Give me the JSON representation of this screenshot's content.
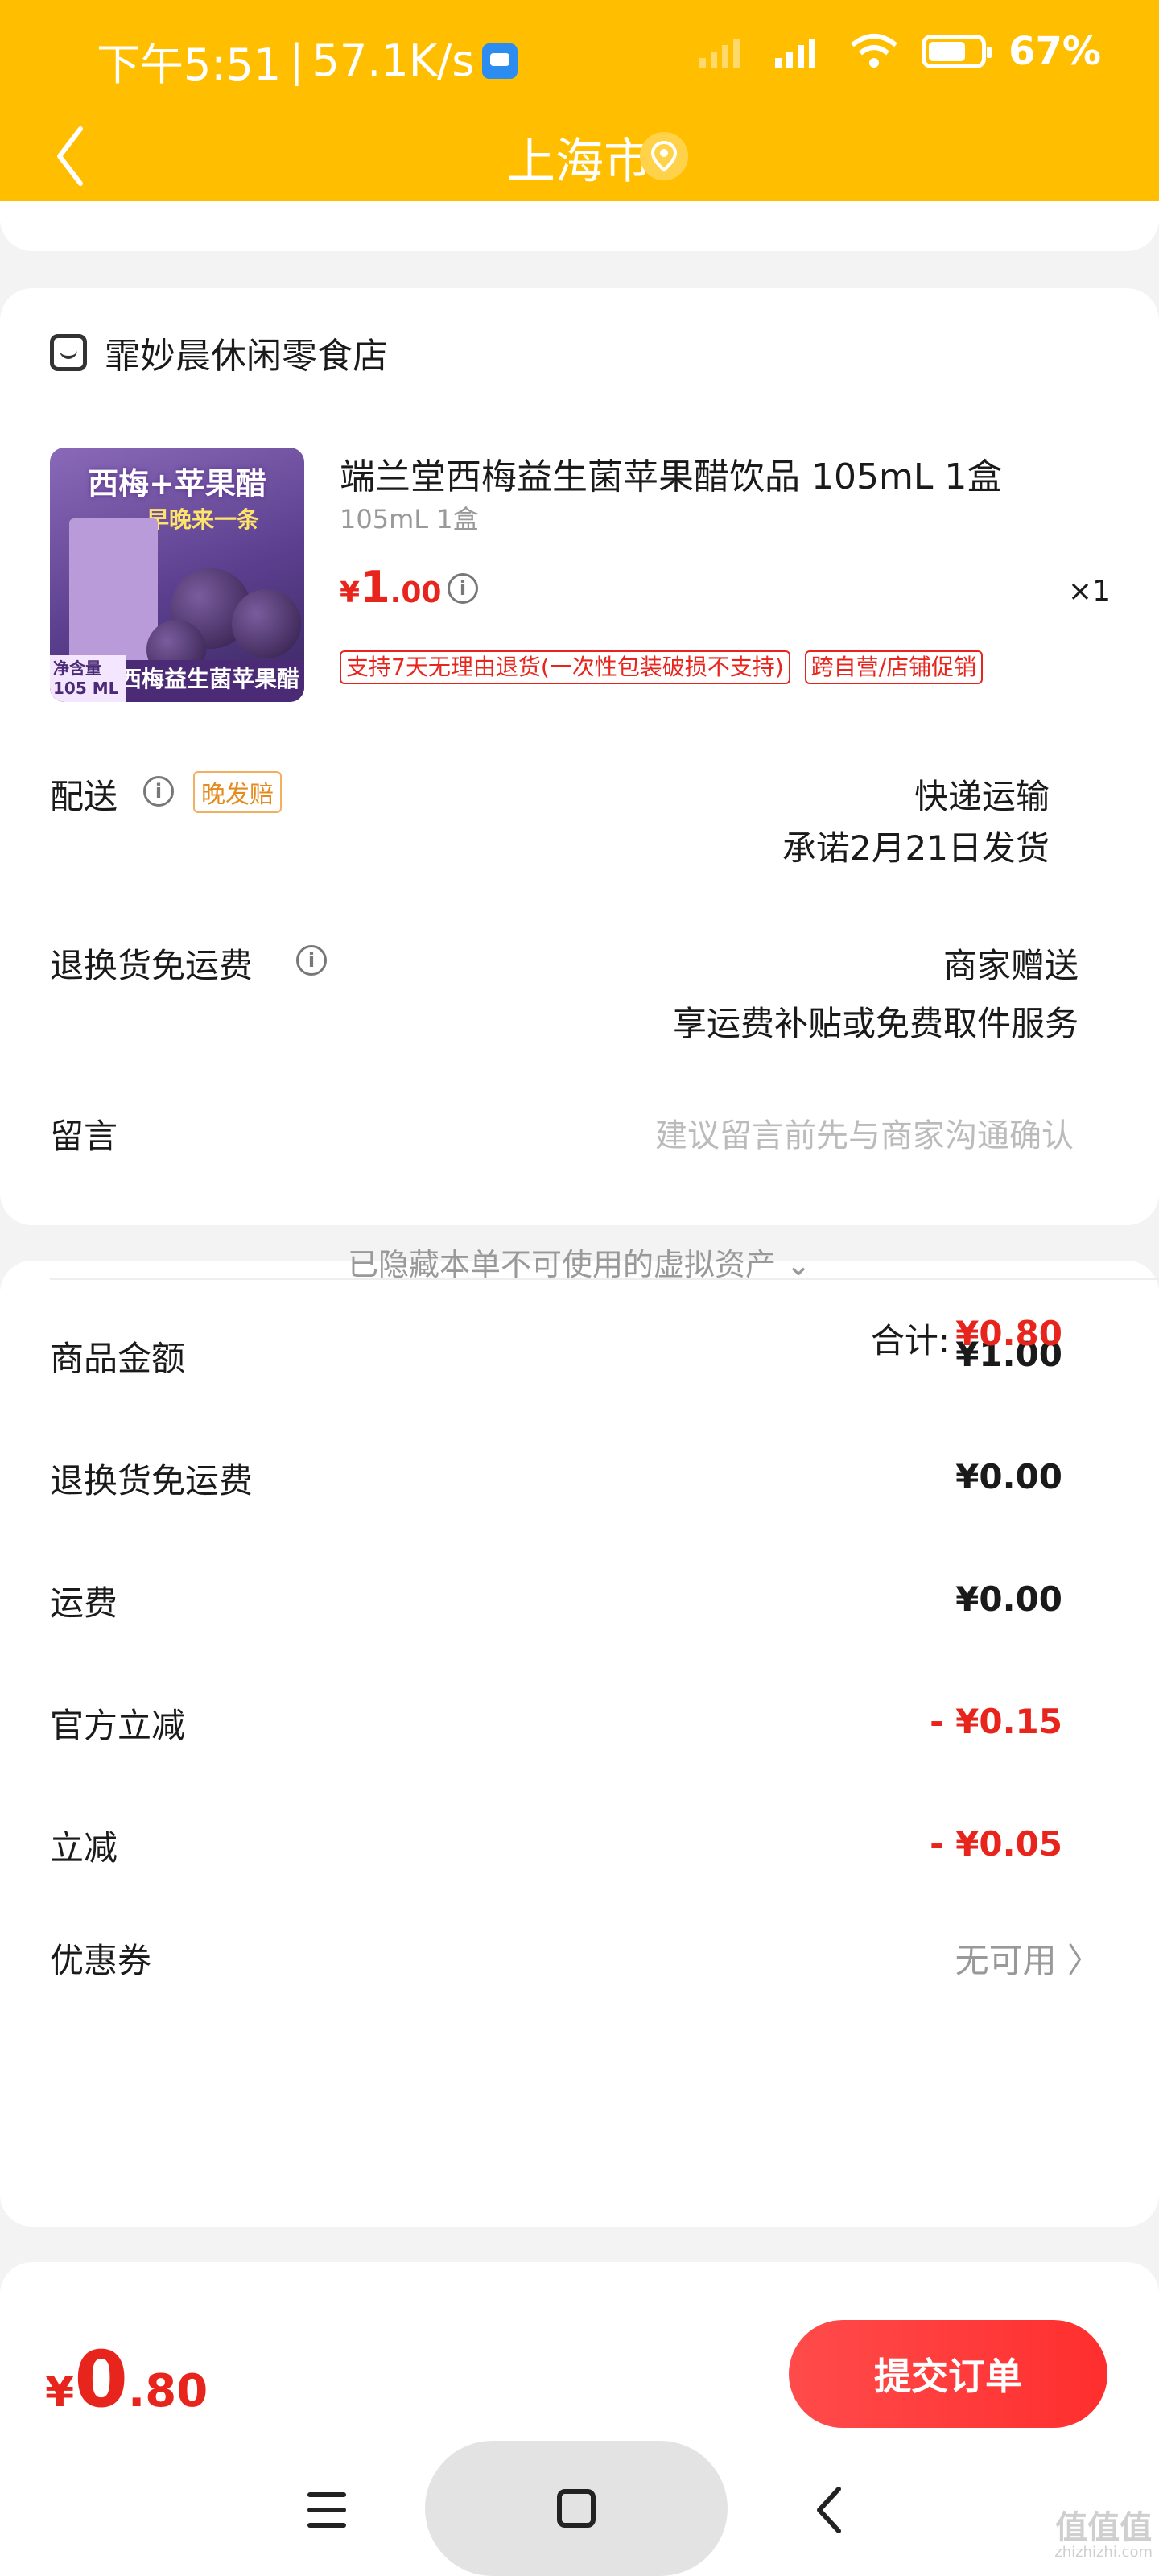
{
  "status_bar": {
    "time": "下午5:51",
    "separator": "|",
    "net_speed": "57.1K/s",
    "battery": "67%"
  },
  "header": {
    "title": "上海市",
    "back_icon": "chevron-left-icon",
    "location_icon": "location-pin-icon"
  },
  "shop": {
    "name": "霏妙晨休闲零食店",
    "icon": "shop-icon"
  },
  "product": {
    "image_texts": {
      "headline": "西梅+苹果醋",
      "subline": "早晚来一条",
      "bottom": "西梅益生菌苹果醋",
      "net_label": "净含量",
      "net_value": "105 ML"
    },
    "title": "端兰堂西梅益生菌苹果醋饮品 105mL 1盒",
    "spec": "105mL 1盒",
    "price_symbol": "¥",
    "price_int": "1",
    "price_dec": ".00",
    "quantity": "×1",
    "tags": [
      "支持7天无理由退货(一次性包装破损不支持)",
      "跨自营/店铺促销"
    ]
  },
  "delivery": {
    "label": "配送",
    "tag": "晚发赔",
    "method": "快递运输",
    "promise": "承诺2月21日发货"
  },
  "return_shipping": {
    "label": "退换货免运费",
    "value": "商家赠送",
    "desc": "享运费补贴或免费取件服务"
  },
  "memo": {
    "label": "留言",
    "placeholder": "建议留言前先与商家沟通确认"
  },
  "summary": {
    "rows": [
      {
        "label": "商品金额",
        "value": "¥1.00"
      },
      {
        "label": "退换货免运费",
        "value": "¥0.00"
      },
      {
        "label": "运费",
        "value": "¥0.00"
      },
      {
        "label": "官方立减",
        "value": "- ¥0.15"
      },
      {
        "label": "立减",
        "value": "- ¥0.05"
      }
    ],
    "coupon_label": "优惠券",
    "coupon_value": "无可用 〉",
    "hidden_assets": "已隐藏本单不可使用的虚拟资产 ⌄",
    "total_label": "合计:",
    "total_value": "¥0.80"
  },
  "footer": {
    "price_symbol": "¥",
    "price_int": "0",
    "price_dec": ".80",
    "submit_label": "提交订单"
  },
  "watermark": {
    "main": "值值值",
    "sub": "zhizhizhi.com"
  },
  "colors": {
    "header_bg": "#ffbf00",
    "price_red": "#e8251d",
    "submit_btn": "#ff3b3b"
  }
}
